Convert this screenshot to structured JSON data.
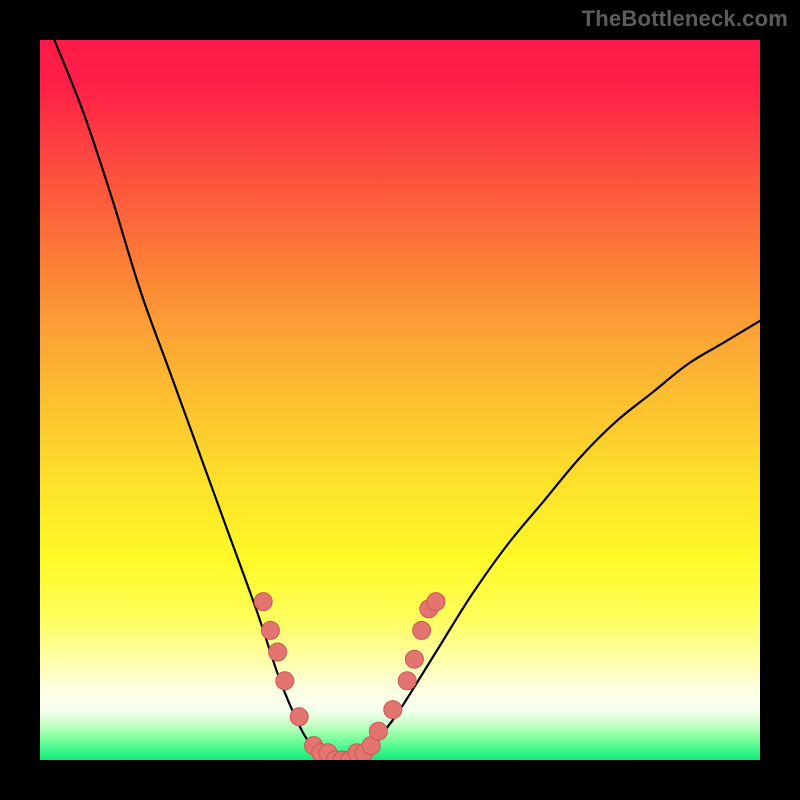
{
  "watermark": "TheBottleneck.com",
  "colors": {
    "curve": "#000000",
    "marker_fill": "#e4746f",
    "marker_stroke": "#c95852",
    "background_frame": "#000000"
  },
  "chart_data": {
    "type": "line",
    "title": "",
    "xlabel": "",
    "ylabel": "",
    "xlim": [
      0,
      100
    ],
    "ylim": [
      0,
      100
    ],
    "grid": false,
    "legend": false,
    "series": [
      {
        "name": "bottleneck-curve",
        "note": "V-shaped curve; values are bottleneck % (y) vs relative hardware balance position (x). Estimated from plot since no axis ticks are rendered.",
        "x": [
          2,
          6,
          10,
          14,
          18,
          22,
          26,
          30,
          33,
          35,
          37,
          39,
          41,
          43,
          45,
          47,
          50,
          55,
          60,
          65,
          70,
          75,
          80,
          85,
          90,
          95,
          100
        ],
        "y": [
          100,
          90,
          78,
          65,
          54,
          43,
          32,
          21,
          12,
          7,
          3,
          1,
          0,
          0,
          1,
          3,
          7,
          15,
          23,
          30,
          36,
          42,
          47,
          51,
          55,
          58,
          61
        ]
      }
    ],
    "markers": {
      "name": "highlighted-points",
      "note": "Salmon dots clustered around the valley; y ≈ bottleneck %.",
      "points": [
        {
          "x": 31,
          "y": 22
        },
        {
          "x": 32,
          "y": 18
        },
        {
          "x": 33,
          "y": 15
        },
        {
          "x": 34,
          "y": 11
        },
        {
          "x": 36,
          "y": 6
        },
        {
          "x": 38,
          "y": 2
        },
        {
          "x": 39,
          "y": 1
        },
        {
          "x": 40,
          "y": 1
        },
        {
          "x": 41,
          "y": 0
        },
        {
          "x": 42,
          "y": 0
        },
        {
          "x": 43,
          "y": 0
        },
        {
          "x": 44,
          "y": 1
        },
        {
          "x": 45,
          "y": 1
        },
        {
          "x": 46,
          "y": 2
        },
        {
          "x": 47,
          "y": 4
        },
        {
          "x": 49,
          "y": 7
        },
        {
          "x": 51,
          "y": 11
        },
        {
          "x": 52,
          "y": 14
        },
        {
          "x": 53,
          "y": 18
        },
        {
          "x": 54,
          "y": 21
        },
        {
          "x": 55,
          "y": 22
        }
      ]
    }
  }
}
